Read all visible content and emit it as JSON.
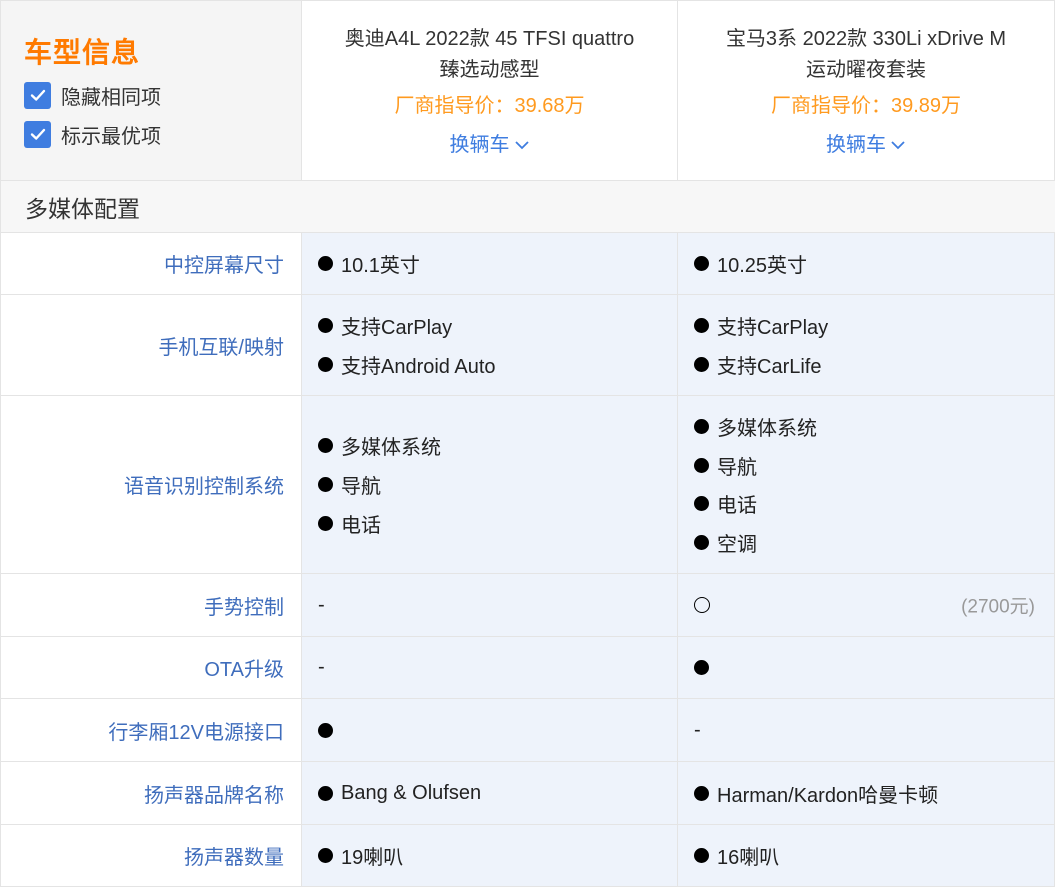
{
  "header": {
    "title": "车型信息",
    "options": [
      {
        "label": "隐藏相同项",
        "checked": true
      },
      {
        "label": "标示最优项",
        "checked": true
      }
    ],
    "cars": [
      {
        "name_line1": "奥迪A4L 2022款 45 TFSI quattro",
        "name_line2": "臻选动感型",
        "price": "厂商指导价：39.68万",
        "change_label": "换辆车"
      },
      {
        "name_line1": "宝马3系 2022款 330Li xDrive M",
        "name_line2": "运动曜夜套装",
        "price": "厂商指导价：39.89万",
        "change_label": "换辆车"
      }
    ]
  },
  "section": {
    "title": "多媒体配置"
  },
  "rows": [
    {
      "label": "中控屏幕尺寸",
      "cells": [
        {
          "items": [
            {
              "mark": "dot",
              "text": "10.1英寸"
            }
          ]
        },
        {
          "items": [
            {
              "mark": "dot",
              "text": "10.25英寸"
            }
          ]
        }
      ]
    },
    {
      "label": "手机互联/映射",
      "cells": [
        {
          "items": [
            {
              "mark": "dot",
              "text": "支持CarPlay"
            },
            {
              "mark": "dot",
              "text": "支持Android Auto"
            }
          ]
        },
        {
          "items": [
            {
              "mark": "dot",
              "text": "支持CarPlay"
            },
            {
              "mark": "dot",
              "text": "支持CarLife"
            }
          ]
        }
      ]
    },
    {
      "label": "语音识别控制系统",
      "cells": [
        {
          "items": [
            {
              "mark": "dot",
              "text": "多媒体系统"
            },
            {
              "mark": "dot",
              "text": "导航"
            },
            {
              "mark": "dot",
              "text": "电话"
            }
          ]
        },
        {
          "items": [
            {
              "mark": "dot",
              "text": "多媒体系统"
            },
            {
              "mark": "dot",
              "text": "导航"
            },
            {
              "mark": "dot",
              "text": "电话"
            },
            {
              "mark": "dot",
              "text": "空调"
            }
          ]
        }
      ]
    },
    {
      "label": "手势控制",
      "cells": [
        {
          "items": [
            {
              "mark": "dash",
              "text": "-"
            }
          ]
        },
        {
          "items": [
            {
              "mark": "ring",
              "text": ""
            }
          ],
          "note": "(2700元)"
        }
      ]
    },
    {
      "label": "OTA升级",
      "cells": [
        {
          "items": [
            {
              "mark": "dash",
              "text": "-"
            }
          ]
        },
        {
          "items": [
            {
              "mark": "dot",
              "text": ""
            }
          ]
        }
      ]
    },
    {
      "label": "行李厢12V电源接口",
      "cells": [
        {
          "items": [
            {
              "mark": "dot",
              "text": ""
            }
          ]
        },
        {
          "items": [
            {
              "mark": "dash",
              "text": "-"
            }
          ]
        }
      ]
    },
    {
      "label": "扬声器品牌名称",
      "cells": [
        {
          "items": [
            {
              "mark": "dot",
              "text": "Bang & Olufsen"
            }
          ]
        },
        {
          "items": [
            {
              "mark": "dot",
              "text": "Harman/Kardon哈曼卡顿"
            }
          ]
        }
      ]
    },
    {
      "label": "扬声器数量",
      "cells": [
        {
          "items": [
            {
              "mark": "dot",
              "text": "19喇叭"
            }
          ]
        },
        {
          "items": [
            {
              "mark": "dot",
              "text": "16喇叭"
            }
          ]
        }
      ]
    }
  ],
  "colors": {
    "accent": "#ff7a00",
    "price": "#ff9a1f",
    "link": "#3f7de0",
    "label": "#3f6dbc",
    "cell_bg": "#eef3fb"
  }
}
